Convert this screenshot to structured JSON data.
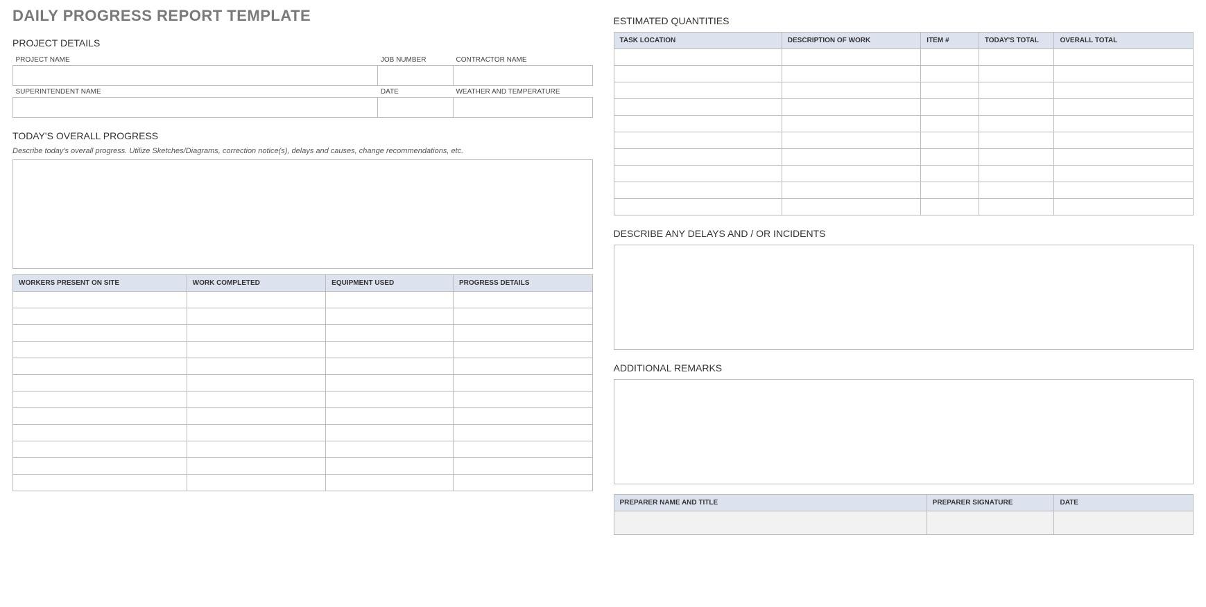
{
  "title": "DAILY PROGRESS REPORT TEMPLATE",
  "project_details": {
    "heading": "PROJECT DETAILS",
    "labels": {
      "project_name": "PROJECT NAME",
      "job_number": "JOB NUMBER",
      "contractor_name": "CONTRACTOR NAME",
      "superintendent_name": "SUPERINTENDENT NAME",
      "date": "DATE",
      "weather": "WEATHER AND TEMPERATURE"
    },
    "values": {
      "project_name": "",
      "job_number": "",
      "contractor_name": "",
      "superintendent_name": "",
      "date": "",
      "weather": ""
    }
  },
  "overall_progress": {
    "heading": "TODAY'S OVERALL PROGRESS",
    "description": "Describe today's overall progress.  Utilize Sketches/Diagrams, correction notice(s), delays and causes, change recommendations, etc.",
    "value": ""
  },
  "work_table": {
    "headers": [
      "WORKERS PRESENT ON SITE",
      "WORK COMPLETED",
      "EQUIPMENT USED",
      "PROGRESS DETAILS"
    ],
    "rows": [
      [
        "",
        "",
        "",
        ""
      ],
      [
        "",
        "",
        "",
        ""
      ],
      [
        "",
        "",
        "",
        ""
      ],
      [
        "",
        "",
        "",
        ""
      ],
      [
        "",
        "",
        "",
        ""
      ],
      [
        "",
        "",
        "",
        ""
      ],
      [
        "",
        "",
        "",
        ""
      ],
      [
        "",
        "",
        "",
        ""
      ],
      [
        "",
        "",
        "",
        ""
      ],
      [
        "",
        "",
        "",
        ""
      ],
      [
        "",
        "",
        "",
        ""
      ],
      [
        "",
        "",
        "",
        ""
      ]
    ]
  },
  "estimated_quantities": {
    "heading": "ESTIMATED QUANTITIES",
    "headers": [
      "TASK LOCATION",
      "DESCRIPTION OF WORK",
      "ITEM #",
      "TODAY'S TOTAL",
      "OVERALL TOTAL"
    ],
    "rows": [
      [
        "",
        "",
        "",
        "",
        ""
      ],
      [
        "",
        "",
        "",
        "",
        ""
      ],
      [
        "",
        "",
        "",
        "",
        ""
      ],
      [
        "",
        "",
        "",
        "",
        ""
      ],
      [
        "",
        "",
        "",
        "",
        ""
      ],
      [
        "",
        "",
        "",
        "",
        ""
      ],
      [
        "",
        "",
        "",
        "",
        ""
      ],
      [
        "",
        "",
        "",
        "",
        ""
      ],
      [
        "",
        "",
        "",
        "",
        ""
      ],
      [
        "",
        "",
        "",
        "",
        ""
      ]
    ]
  },
  "delays": {
    "heading": "DESCRIBE ANY DELAYS AND / OR INCIDENTS",
    "value": ""
  },
  "remarks": {
    "heading": "ADDITIONAL REMARKS",
    "value": ""
  },
  "preparer": {
    "headers": [
      "PREPARER NAME AND TITLE",
      "PREPARER SIGNATURE",
      "DATE"
    ],
    "values": [
      "",
      "",
      ""
    ]
  }
}
